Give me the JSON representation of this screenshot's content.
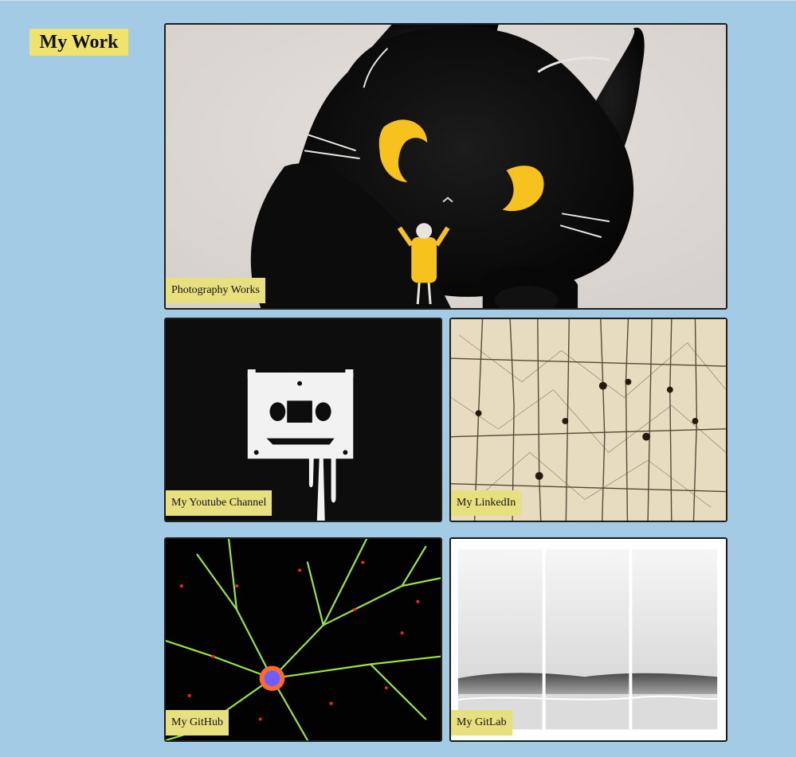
{
  "section": {
    "title": "My Work"
  },
  "cards": [
    {
      "id": "photography",
      "label": "Photography Works",
      "image": "black-cat-illustration"
    },
    {
      "id": "youtube",
      "label": "My Youtube Channel",
      "image": "cassette-tape-drip"
    },
    {
      "id": "linkedin",
      "label": "My LinkedIn",
      "image": "neurons-sepia-drawing"
    },
    {
      "id": "github",
      "label": "My GitHub",
      "image": "neuron-fluorescence"
    },
    {
      "id": "gitlab",
      "label": "My GitLab",
      "image": "sea-wave-triptych"
    }
  ],
  "colors": {
    "background": "#a3cbe5",
    "title_badge": "#efe36c",
    "label_badge": "#e8df7e",
    "card_border": "#1f1f1f"
  }
}
